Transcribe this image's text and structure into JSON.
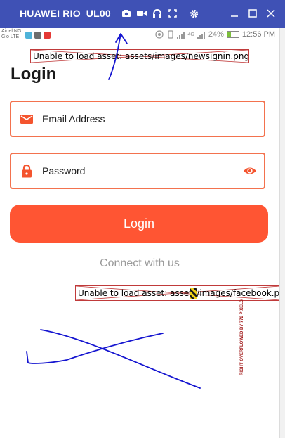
{
  "window": {
    "title": "HUAWEI RIO_UL00",
    "icons": [
      "camera-icon",
      "video-icon",
      "headset-icon",
      "fullscreen-icon",
      "settings-icon"
    ],
    "controls": [
      "minimize-icon",
      "maximize-icon",
      "close-icon"
    ]
  },
  "status_bar": {
    "carrier_line1": "Airtel NG",
    "carrier_line2": "Glo LTE",
    "signal_tag": "4G",
    "battery": "24%",
    "time": "12:56 PM"
  },
  "header_image_error": "Unable to load asset: assets/images/newsignin.png",
  "title": "Login",
  "email_field": {
    "label": "Email Address",
    "icon": "mail-icon"
  },
  "password_field": {
    "label": "Password",
    "icon": "lock-icon",
    "toggle_icon": "eye-icon"
  },
  "login_button": "Login",
  "connect_text": "Connect with us",
  "facebook_image_error": "Unable to load asset: assets/images/facebook.png",
  "overflow_warning": "RIGHT OVERFLOWED BY 772 PIXELS",
  "colors": {
    "accent": "#ff5533",
    "border": "#f3724e",
    "window_bar": "#3f51b5",
    "annotation": "#1515d0"
  }
}
